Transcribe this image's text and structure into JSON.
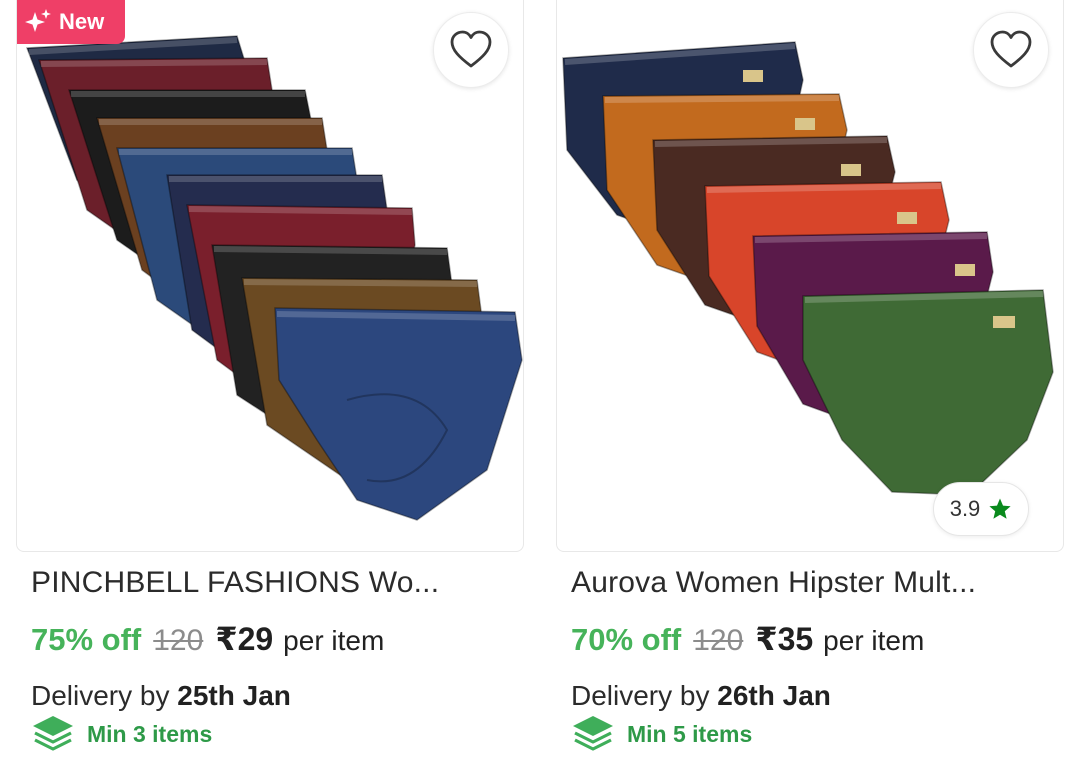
{
  "colors": {
    "accent_green": "#46b35a",
    "badge_pink": "#ef3f67",
    "rating_star": "#0a8a1d"
  },
  "products": [
    {
      "badge": "New",
      "title": "PINCHBELL FASHIONS Wo...",
      "discount": "75% off",
      "mrp": "120",
      "price": "₹29",
      "per_item": "per item",
      "delivery_prefix": "Delivery by",
      "delivery_date": "25th Jan",
      "min_items": "Min 3 items",
      "wishlist_icon": "heart-outline-icon",
      "colors_shown": [
        "#1f2a44",
        "#6b1f2a",
        "#1c1c1c",
        "#6b4020",
        "#2b4a7a",
        "#242c4e",
        "#7a1f2c",
        "#222222",
        "#6b4a22",
        "#2c477e"
      ]
    },
    {
      "badge": "",
      "title": "Aurova Women Hipster Mult...",
      "discount": "70% off",
      "mrp": "120",
      "price": "₹35",
      "per_item": "per item",
      "delivery_prefix": "Delivery by",
      "delivery_date": "26th Jan",
      "min_items": "Min 5 items",
      "rating": "3.9",
      "wishlist_icon": "heart-outline-icon",
      "colors_shown": [
        "#1f2b4a",
        "#c26a1e",
        "#4a2a22",
        "#d8452a",
        "#5a1a4a",
        "#3f6a35"
      ]
    }
  ]
}
